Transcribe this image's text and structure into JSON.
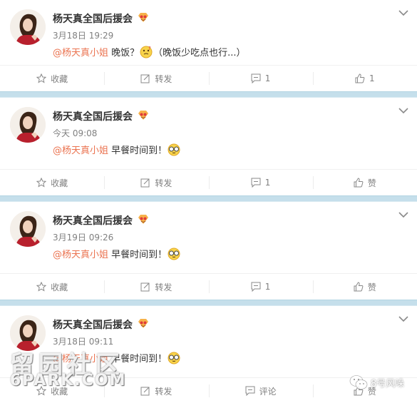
{
  "posts": [
    {
      "author": "杨天真全国后援会",
      "time": "3月18日 19:29",
      "mention": "@杨天真小姐",
      "text_before": " 晚饭？",
      "text_after": "（晚饭少吃点也行...）",
      "emoji": "thinking-emoji",
      "actions": {
        "favorite": "收藏",
        "repost": "转发",
        "comment": "1",
        "like": "1"
      }
    },
    {
      "author": "杨天真全国后援会",
      "time": "今天 09:08",
      "mention": "@杨天真小姐",
      "text_before": " 早餐时间到！",
      "text_after": "",
      "emoji": "glasses-emoji",
      "actions": {
        "favorite": "收藏",
        "repost": "转发",
        "comment": "1",
        "like": "赞"
      }
    },
    {
      "author": "杨天真全国后援会",
      "time": "3月19日 09:26",
      "mention": "@杨天真小姐",
      "text_before": " 早餐时间到！",
      "text_after": "",
      "emoji": "glasses-emoji",
      "actions": {
        "favorite": "收藏",
        "repost": "转发",
        "comment": "1",
        "like": "赞"
      }
    },
    {
      "author": "杨天真全国后援会",
      "time": "3月18日 09:11",
      "mention": "@杨天真小姐",
      "text_before": " 早餐时间到！",
      "text_after": "",
      "emoji": "glasses-emoji",
      "actions": {
        "favorite": "收藏",
        "repost": "转发",
        "comment": "评论",
        "like": "赞"
      }
    }
  ],
  "watermark": {
    "site_cn": "留园社区",
    "site_en": "6PARK.COM",
    "wechat_account": "8号风哚"
  },
  "colors": {
    "mention": "#eb7350",
    "divider": "#c5dfeb",
    "muted": "#808080"
  }
}
